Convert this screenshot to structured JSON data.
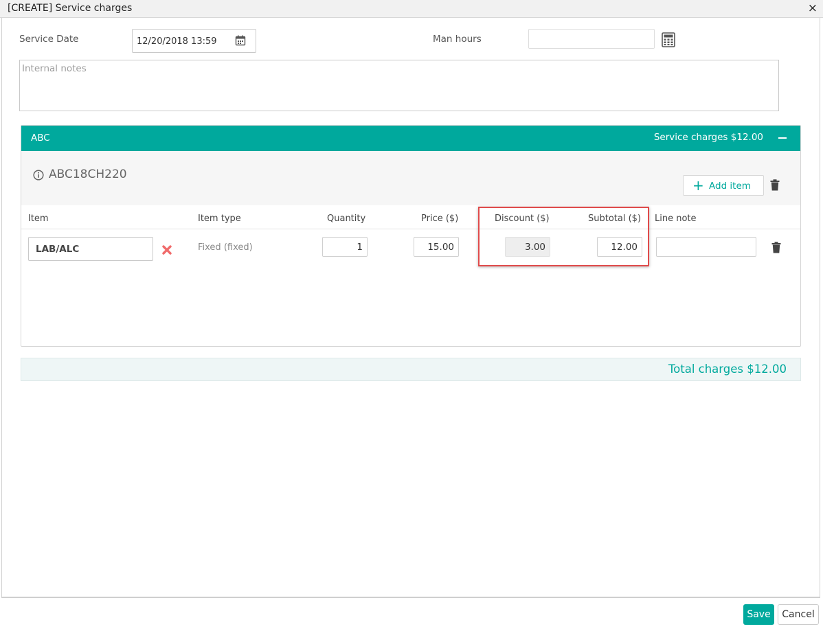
{
  "window": {
    "title": "[CREATE] Service charges",
    "close_glyph": "×"
  },
  "form": {
    "service_date_label": "Service Date",
    "service_date_value": "12/20/2018 13:59",
    "man_hours_label": "Man hours",
    "man_hours_value": "",
    "notes_placeholder": "Internal notes"
  },
  "group": {
    "name": "ABC",
    "summary": "Service charges $12.00",
    "code": "ABC18CH220",
    "add_item_label": "Add item",
    "columns": [
      "Item",
      "Item type",
      "Quantity",
      "Price ($)",
      "Discount ($)",
      "Subtotal ($)",
      "Line note"
    ],
    "rows": [
      {
        "item": "LAB/ALC",
        "item_type": "Fixed (fixed)",
        "quantity": "1",
        "price": "15.00",
        "discount": "3.00",
        "subtotal": "12.00",
        "line_note": ""
      }
    ]
  },
  "total": {
    "label": "Total charges $12.00"
  },
  "footer": {
    "save_label": "Save",
    "cancel_label": "Cancel"
  },
  "colors": {
    "accent": "#00a99d",
    "highlight": "#e04b4b",
    "remove": "#f06b6b"
  },
  "icons": [
    "calendar-icon",
    "calculator-icon",
    "info-icon",
    "plus-icon",
    "trash-icon",
    "remove-x-icon",
    "minus-icon",
    "close-icon"
  ]
}
